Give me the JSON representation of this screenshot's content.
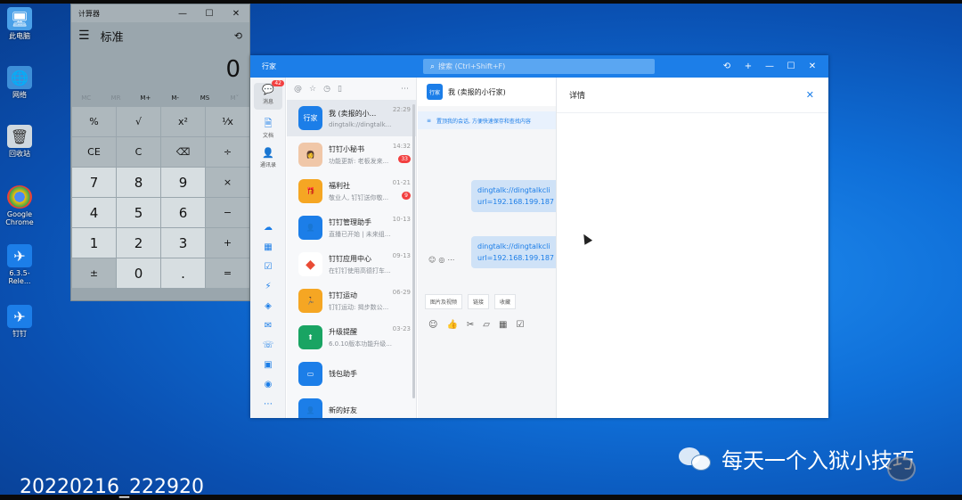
{
  "desktop": {
    "icons": [
      {
        "label": "此电脑",
        "icon": "computer-icon"
      },
      {
        "label": "网络",
        "icon": "network-icon"
      },
      {
        "label": "回收站",
        "icon": "recycle-bin-icon"
      },
      {
        "label": "Google Chrome",
        "icon": "chrome-icon"
      },
      {
        "label": "6.3.5-Rele...",
        "icon": "dingtalk-installer-icon"
      },
      {
        "label": "钉钉",
        "icon": "dingtalk-icon"
      }
    ]
  },
  "calculator": {
    "title": "计算器",
    "mode": "标准",
    "display": "0",
    "memory": [
      "MC",
      "MR",
      "M+",
      "M-",
      "MS",
      "M˅"
    ],
    "keys": [
      "%",
      "√",
      "x²",
      "¹⁄x",
      "CE",
      "C",
      "⌫",
      "÷",
      "7",
      "8",
      "9",
      "×",
      "4",
      "5",
      "6",
      "−",
      "1",
      "2",
      "3",
      "+",
      "±",
      "0",
      ".",
      "="
    ]
  },
  "dingtalk": {
    "brand": "行家",
    "search_placeholder": "搜索 (Ctrl+Shift+F)",
    "nav": {
      "messages_label": "消息",
      "messages_badge": "42",
      "docs_label": "文档",
      "contacts_label": "通讯录"
    },
    "conversations": [
      {
        "name": "我 (卖报的小...",
        "preview": "dingtalk://dingtalk...",
        "time": "22:29",
        "badge": "",
        "avatar_text": "行家",
        "color": "#1c7ee8"
      },
      {
        "name": "钉钉小秘书",
        "preview": "功能更新: 老板发来...",
        "time": "14:32",
        "badge": "33",
        "avatar_text": "",
        "color": "#f0c7a8"
      },
      {
        "name": "福利社",
        "preview": "敬业人, 钉钉送你敬...",
        "time": "01-21",
        "badge": "9",
        "avatar_text": "🎁",
        "color": "#f5a623"
      },
      {
        "name": "钉钉管理助手",
        "preview": "直播已开始 | 未来组...",
        "time": "10-13",
        "badge": "",
        "avatar_text": "👤",
        "color": "#1c7ee8"
      },
      {
        "name": "钉钉应用中心",
        "preview": "在钉钉使用高德打车...",
        "time": "09-13",
        "badge": "",
        "avatar_text": "◆",
        "color": "#ffffff"
      },
      {
        "name": "钉钉运动",
        "preview": "钉钉运动: 揭步数公...",
        "time": "06-29",
        "badge": "",
        "avatar_text": "🏃",
        "color": "#f5a623"
      },
      {
        "name": "升级提醒",
        "preview": "6.0.10版本功能升级...",
        "time": "03-23",
        "badge": "",
        "avatar_text": "⬆",
        "color": "#19a463"
      },
      {
        "name": "钱包助手",
        "preview": "",
        "time": "",
        "badge": "",
        "avatar_text": "▭",
        "color": "#1c7ee8"
      },
      {
        "name": "新的好友",
        "preview": "",
        "time": "",
        "badge": "",
        "avatar_text": "👤",
        "color": "#1c7ee8"
      }
    ],
    "chat": {
      "title": "我 (卖报的小行家)",
      "avatar_text": "行家",
      "notice": "置顶我的会话, 方便快速保存和查找内容",
      "bubbles": [
        {
          "line1": "dingtalk://dingtalkcli",
          "line2": "url=192.168.199.187"
        },
        {
          "line1": "dingtalk://dingtalkcli",
          "line2": "url=192.168.199.187"
        }
      ],
      "chips": [
        "图片及视频",
        "链接",
        "收藏"
      ]
    },
    "detail": {
      "title": "详情"
    }
  },
  "overlay": {
    "watermark": "每天一个入狱小技巧",
    "timestamp": "20220216_222920"
  }
}
